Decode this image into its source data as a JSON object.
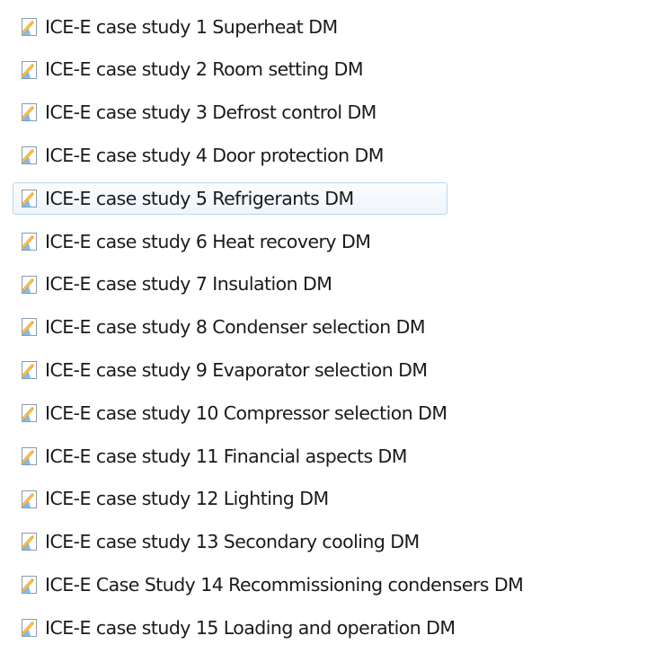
{
  "selected_index": 4,
  "items": [
    {
      "label": "ICE-E case study 1 Superheat DM"
    },
    {
      "label": "ICE-E case study 2 Room setting DM"
    },
    {
      "label": "ICE-E case study 3 Defrost control DM"
    },
    {
      "label": "ICE-E case study 4 Door protection DM"
    },
    {
      "label": "ICE-E case study 5 Refrigerants DM"
    },
    {
      "label": "ICE-E case study 6 Heat recovery DM"
    },
    {
      "label": "ICE-E case study 7 Insulation DM"
    },
    {
      "label": "ICE-E case study 8 Condenser selection DM"
    },
    {
      "label": "ICE-E case study 9 Evaporator selection DM"
    },
    {
      "label": "ICE-E case study 10 Compressor selection DM"
    },
    {
      "label": "ICE-E case study 11 Financial aspects DM"
    },
    {
      "label": "ICE-E case study 12 Lighting DM"
    },
    {
      "label": "ICE-E case study 13 Secondary cooling DM"
    },
    {
      "label": "ICE-E Case Study 14 Recommissioning condensers DM"
    },
    {
      "label": "ICE-E case study 15 Loading and operation DM"
    }
  ]
}
